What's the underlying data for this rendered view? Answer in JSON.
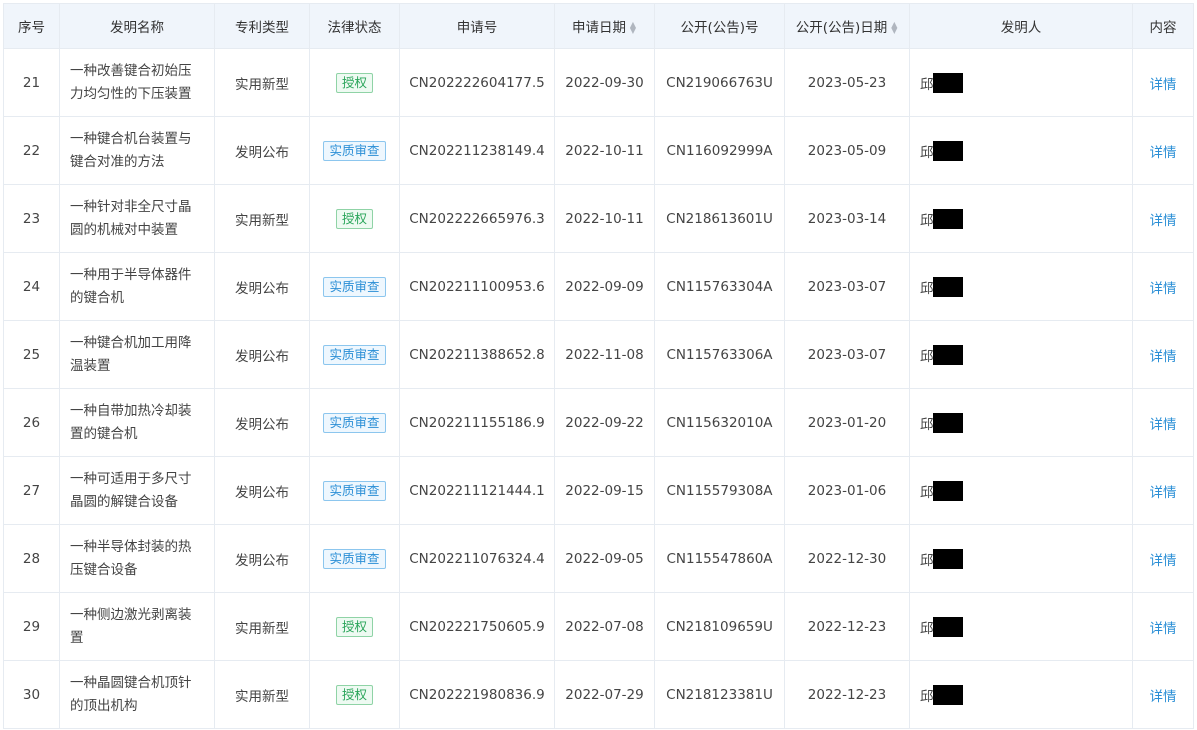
{
  "columns": {
    "no": "序号",
    "name": "发明名称",
    "type": "专利类型",
    "status": "法律状态",
    "app_no": "申请号",
    "app_date": "申请日期",
    "pub_no": "公开(公告)号",
    "pub_date": "公开(公告)日期",
    "inventor": "发明人",
    "content": "内容"
  },
  "sort_icons": {
    "up": "▲",
    "down": "▼",
    "icon_name": "sort-caret-icon"
  },
  "colors": {
    "header_bg": "#f0f5fb",
    "border": "#e6ebf1",
    "granted_tag": "#2aa55a",
    "exam_tag": "#2b8fd6",
    "link": "#2b8fd6",
    "redaction": "#000000"
  },
  "rows": [
    {
      "no": "21",
      "name": "一种改善键合初始压力均匀性的下压装置",
      "type": "实用新型",
      "status": "授权",
      "status_kind": "green",
      "app_no": "CN202222604177.5",
      "app_date": "2022-09-30",
      "pub_no": "CN219066763U",
      "pub_date": "2023-05-23",
      "inventor": "邱",
      "detail": "详情"
    },
    {
      "no": "22",
      "name": "一种键合机台装置与键合对准的方法",
      "type": "发明公布",
      "status": "实质审查",
      "status_kind": "blue",
      "app_no": "CN202211238149.4",
      "app_date": "2022-10-11",
      "pub_no": "CN116092999A",
      "pub_date": "2023-05-09",
      "inventor": "邱",
      "detail": "详情"
    },
    {
      "no": "23",
      "name": "一种针对非全尺寸晶圆的机械对中装置",
      "type": "实用新型",
      "status": "授权",
      "status_kind": "green",
      "app_no": "CN202222665976.3",
      "app_date": "2022-10-11",
      "pub_no": "CN218613601U",
      "pub_date": "2023-03-14",
      "inventor": "邱",
      "detail": "详情"
    },
    {
      "no": "24",
      "name": "一种用于半导体器件的键合机",
      "type": "发明公布",
      "status": "实质审查",
      "status_kind": "blue",
      "app_no": "CN202211100953.6",
      "app_date": "2022-09-09",
      "pub_no": "CN115763304A",
      "pub_date": "2023-03-07",
      "inventor": "邱",
      "detail": "详情"
    },
    {
      "no": "25",
      "name": "一种键合机加工用降温装置",
      "type": "发明公布",
      "status": "实质审查",
      "status_kind": "blue",
      "app_no": "CN202211388652.8",
      "app_date": "2022-11-08",
      "pub_no": "CN115763306A",
      "pub_date": "2023-03-07",
      "inventor": "邱",
      "detail": "详情"
    },
    {
      "no": "26",
      "name": "一种自带加热冷却装置的键合机",
      "type": "发明公布",
      "status": "实质审查",
      "status_kind": "blue",
      "app_no": "CN202211155186.9",
      "app_date": "2022-09-22",
      "pub_no": "CN115632010A",
      "pub_date": "2023-01-20",
      "inventor": "邱",
      "detail": "详情"
    },
    {
      "no": "27",
      "name": "一种可适用于多尺寸晶圆的解键合设备",
      "type": "发明公布",
      "status": "实质审查",
      "status_kind": "blue",
      "app_no": "CN202211121444.1",
      "app_date": "2022-09-15",
      "pub_no": "CN115579308A",
      "pub_date": "2023-01-06",
      "inventor": "邱",
      "detail": "详情"
    },
    {
      "no": "28",
      "name": "一种半导体封装的热压键合设备",
      "type": "发明公布",
      "status": "实质审查",
      "status_kind": "blue",
      "app_no": "CN202211076324.4",
      "app_date": "2022-09-05",
      "pub_no": "CN115547860A",
      "pub_date": "2022-12-30",
      "inventor": "邱",
      "detail": "详情"
    },
    {
      "no": "29",
      "name": "一种侧边激光剥离装置",
      "type": "实用新型",
      "status": "授权",
      "status_kind": "green",
      "app_no": "CN202221750605.9",
      "app_date": "2022-07-08",
      "pub_no": "CN218109659U",
      "pub_date": "2022-12-23",
      "inventor": "邱",
      "detail": "详情"
    },
    {
      "no": "30",
      "name": "一种晶圆键合机顶针的顶出机构",
      "type": "实用新型",
      "status": "授权",
      "status_kind": "green",
      "app_no": "CN202221980836.9",
      "app_date": "2022-07-29",
      "pub_no": "CN218123381U",
      "pub_date": "2022-12-23",
      "inventor": "邱",
      "detail": "详情"
    }
  ]
}
